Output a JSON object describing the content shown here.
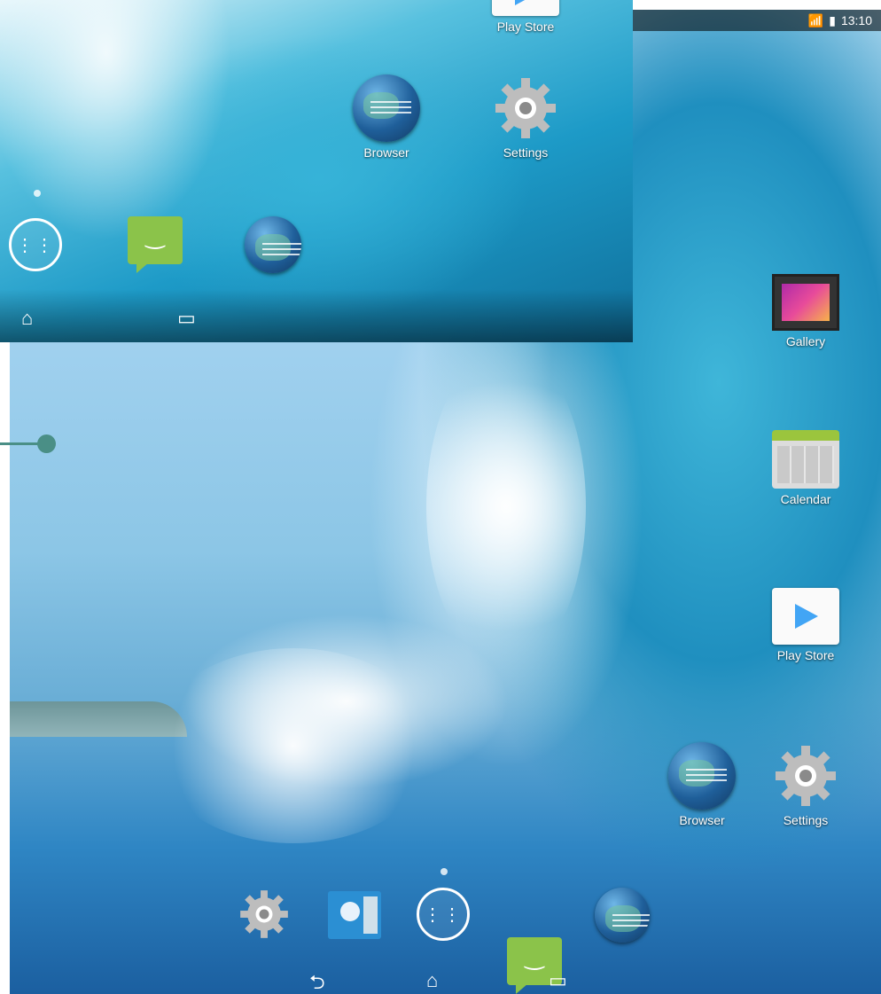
{
  "status_bar": {
    "time": "13:10",
    "wifi_icon": "wifi-icon",
    "signal_icon": "signal-icon",
    "battery_icon": "battery-icon"
  },
  "overlay_preview": {
    "apps": [
      {
        "label": "Play Store"
      },
      {
        "label": "Browser"
      },
      {
        "label": "Settings"
      }
    ],
    "dock_icons": [
      "all-apps-icon",
      "messaging-icon",
      "browser-icon"
    ],
    "nav_icons": [
      "home-icon",
      "recents-icon"
    ]
  },
  "home_screen": {
    "apps": [
      {
        "label": "Gallery"
      },
      {
        "label": "Calendar"
      },
      {
        "label": "Play Store"
      },
      {
        "label": "Browser"
      },
      {
        "label": "Settings"
      }
    ],
    "dock_icons": [
      "settings-icon",
      "contacts-icon",
      "all-apps-icon",
      "messaging-icon",
      "browser-icon"
    ],
    "nav_icons": [
      "back-icon",
      "home-icon",
      "recents-icon"
    ]
  },
  "colors": {
    "accent": "#4a8f86",
    "messaging": "#8bc34a",
    "contacts": "#2b8fd3"
  }
}
